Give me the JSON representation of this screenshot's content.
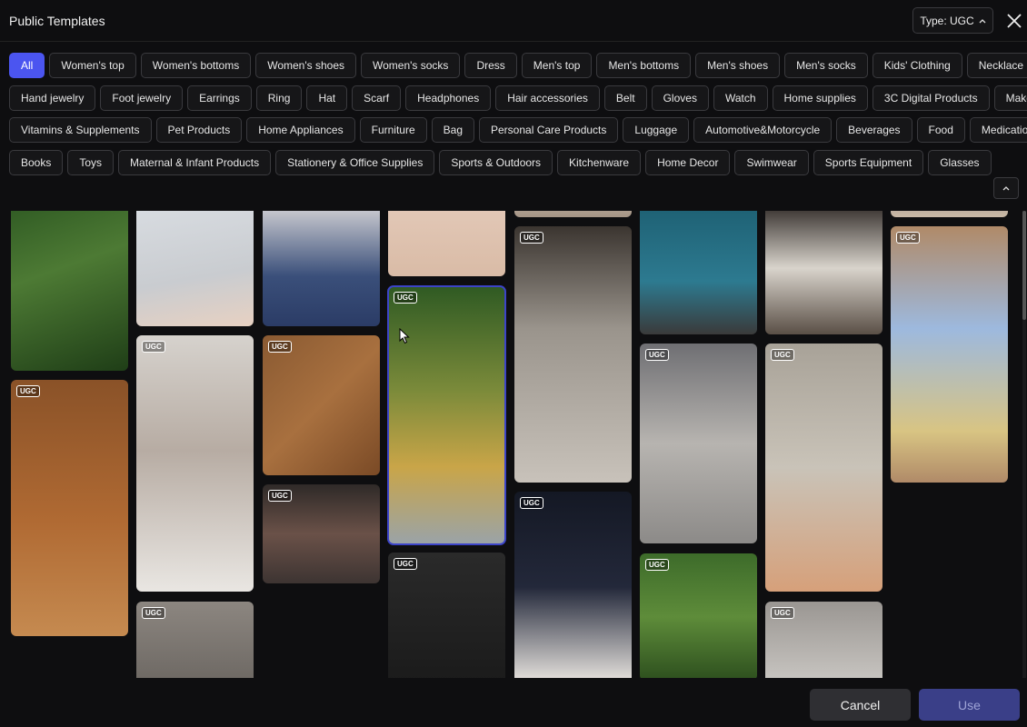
{
  "header": {
    "title": "Public Templates",
    "type_filter": "Type: UGC"
  },
  "categories": {
    "row1": [
      "All",
      "Women's top",
      "Women's bottoms",
      "Women's shoes",
      "Women's socks",
      "Dress",
      "Men's top",
      "Men's bottoms",
      "Men's shoes",
      "Men's socks",
      "Kids' Clothing",
      "Necklace"
    ],
    "row2": [
      "Hand jewelry",
      "Foot jewelry",
      "Earrings",
      "Ring",
      "Hat",
      "Scarf",
      "Headphones",
      "Hair accessories",
      "Belt",
      "Gloves",
      "Watch",
      "Home supplies",
      "3C Digital Products",
      "Makeup"
    ],
    "row3": [
      "Vitamins & Supplements",
      "Pet Products",
      "Home Appliances",
      "Furniture",
      "Bag",
      "Personal Care Products",
      "Luggage",
      "Automotive&Motorcycle",
      "Beverages",
      "Food",
      "Medications"
    ],
    "row4": [
      "Books",
      "Toys",
      "Maternal & Infant Products",
      "Stationery & Office Supplies",
      "Sports & Outdoors",
      "Kitchenware",
      "Home Decor",
      "Swimwear",
      "Sports Equipment",
      "Glasses"
    ],
    "selected": "All"
  },
  "gallery": {
    "badge": "UGC",
    "items": [
      {
        "icon": "skincare-spray-bottle-photo"
      },
      {
        "icon": "serum-dropper-bottle-photo"
      },
      {
        "icon": "hand-holding-can-photo"
      },
      {
        "icon": "woman-holding-sunscreen-photo"
      },
      {
        "icon": "sneakers-photo"
      },
      {
        "icon": "jeans-outfit-photo"
      },
      {
        "icon": "shampoo-bottle-on-wood-photo"
      },
      {
        "icon": "ping-pong-paddle-photo"
      },
      {
        "icon": "hand-photo"
      },
      {
        "icon": "shampoo-bottle-photo"
      },
      {
        "icon": "tennis-racket-photo"
      },
      {
        "icon": "street-style-woman-photo"
      },
      {
        "icon": "wrist-watch-photo"
      },
      {
        "icon": "badminton-racket-photo"
      },
      {
        "icon": "facial-device-photo"
      },
      {
        "icon": "lip-balm-photo"
      },
      {
        "icon": "white-dress-photo"
      },
      {
        "icon": "drink-bottle-photo"
      },
      {
        "icon": "pump-bottle-photo"
      },
      {
        "icon": "kids-sweater-vest-photo"
      }
    ]
  },
  "footer": {
    "cancel": "Cancel",
    "use": "Use"
  },
  "colors": {
    "accent": "#4b55f0",
    "background": "#0e0e10",
    "chip_border": "#3a3a3e"
  }
}
